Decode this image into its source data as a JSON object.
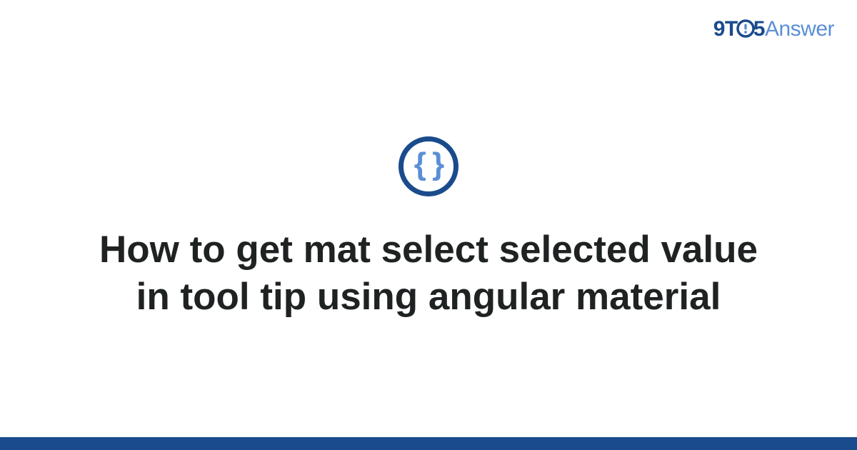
{
  "brand": {
    "part_9t": "9T",
    "part_5": "5",
    "part_answer": "Answer"
  },
  "badge": {
    "glyph": "{ }"
  },
  "title": "How to get mat select selected value in tool tip using angular material",
  "colors": {
    "primary": "#1a4b8c",
    "accent": "#5a8fd6"
  }
}
